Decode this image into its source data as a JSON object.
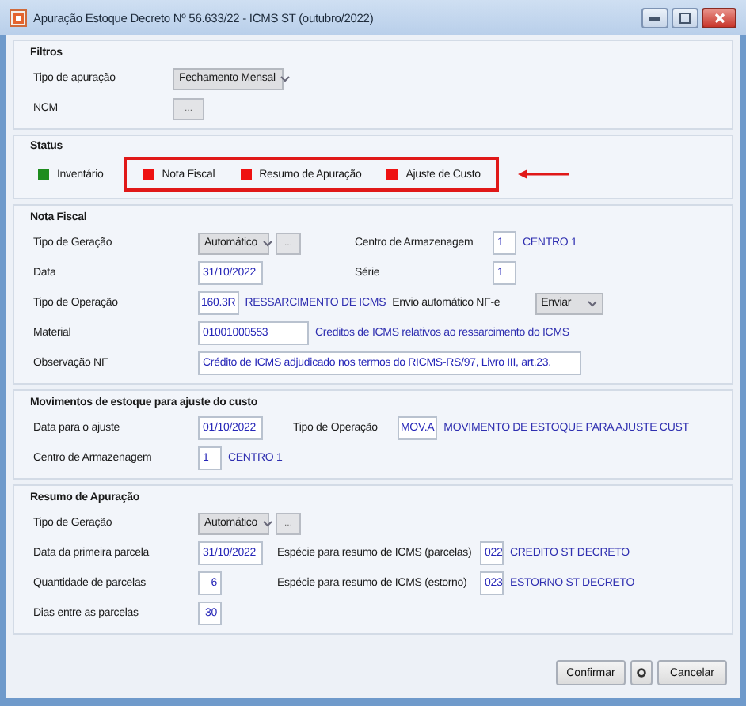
{
  "window": {
    "title": "Apuração Estoque Decreto Nº 56.633/22 - ICMS ST (outubro/2022)"
  },
  "filtros": {
    "title": "Filtros",
    "tipo_apuracao": {
      "label": "Tipo de apuração",
      "value": "Fechamento Mensal"
    },
    "ncm": {
      "label": "NCM",
      "button": "..."
    }
  },
  "status": {
    "title": "Status",
    "items": [
      {
        "label": "Inventário",
        "color": "#1e8c1e",
        "highlighted": false
      },
      {
        "label": "Nota Fiscal",
        "color": "#ee1111",
        "highlighted": true
      },
      {
        "label": "Resumo de Apuração",
        "color": "#ee1111",
        "highlighted": true
      },
      {
        "label": "Ajuste de Custo",
        "color": "#ee1111",
        "highlighted": true
      }
    ]
  },
  "nota_fiscal": {
    "title": "Nota Fiscal",
    "tipo_geracao": {
      "label": "Tipo de Geração",
      "value": "Automático",
      "button": "..."
    },
    "centro": {
      "label": "Centro de Armazenagem",
      "value": "1",
      "name": "CENTRO 1"
    },
    "data": {
      "label": "Data",
      "value": "31/10/2022"
    },
    "serie": {
      "label": "Série",
      "value": "1"
    },
    "tipo_operacao": {
      "label": "Tipo de Operação",
      "value": "160.3R",
      "name": "RESSARCIMENTO DE ICMS"
    },
    "envio": {
      "label": "Envio automático NF-e",
      "value": "Enviar"
    },
    "material": {
      "label": "Material",
      "value": "01001000553",
      "name": "Creditos de ICMS relativos ao ressarcimento do ICMS"
    },
    "observacao": {
      "label": "Observação NF",
      "value": "Crédito de ICMS adjudicado nos termos do RICMS-RS/97, Livro III, art.23."
    }
  },
  "movimentos": {
    "title": "Movimentos de estoque para ajuste do custo",
    "data": {
      "label": "Data para o ajuste",
      "value": "01/10/2022"
    },
    "tipo_operacao": {
      "label": "Tipo de Operação",
      "value": "MOV.A",
      "name": "MOVIMENTO DE ESTOQUE PARA AJUSTE CUST"
    },
    "centro": {
      "label": "Centro de Armazenagem",
      "value": "1",
      "name": "CENTRO 1"
    }
  },
  "resumo": {
    "title": "Resumo de Apuração",
    "tipo_geracao": {
      "label": "Tipo de Geração",
      "value": "Automático",
      "button": "..."
    },
    "data": {
      "label": "Data da primeira parcela",
      "value": "31/10/2022"
    },
    "especie_parcelas": {
      "label": "Espécie para resumo de ICMS (parcelas)",
      "value": "022",
      "name": "CREDITO ST DECRETO"
    },
    "quantidade": {
      "label": "Quantidade de parcelas",
      "value": "6"
    },
    "especie_estorno": {
      "label": "Espécie para resumo de ICMS (estorno)",
      "value": "023",
      "name": "ESTORNO ST DECRETO"
    },
    "dias": {
      "label": "Dias entre as parcelas",
      "value": "30"
    }
  },
  "buttons": {
    "confirm": "Confirmar",
    "cancel": "Cancelar"
  }
}
